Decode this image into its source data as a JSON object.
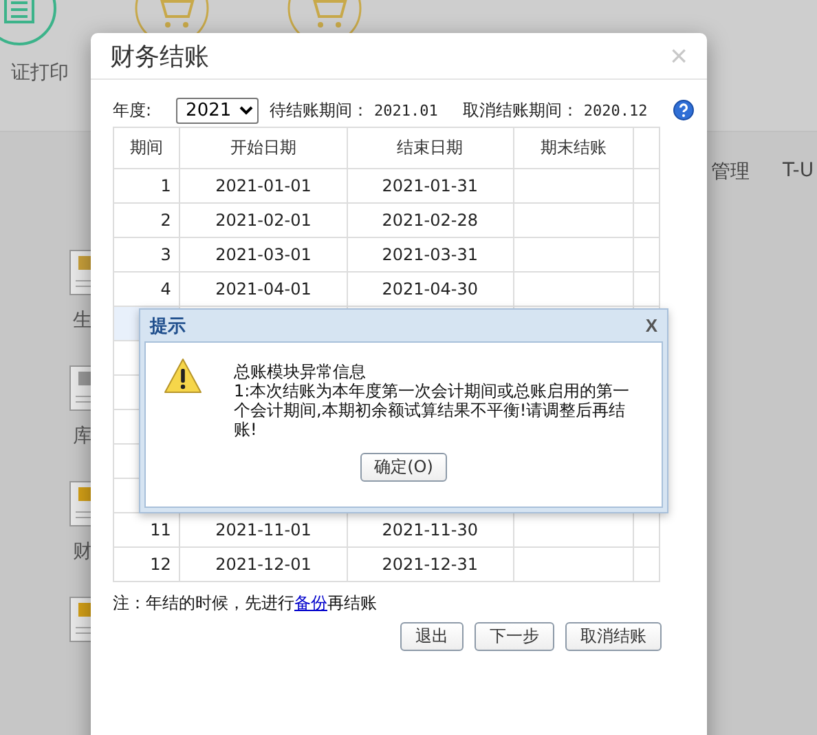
{
  "background": {
    "top_items": [
      {
        "kind": "document",
        "label": "证打印"
      },
      {
        "kind": "cart"
      },
      {
        "kind": "cart"
      }
    ],
    "side_items": [
      {
        "kind": "production",
        "label": "生"
      },
      {
        "kind": "storage",
        "label": "库"
      },
      {
        "kind": "finance",
        "label": "财"
      },
      {
        "kind": "finance"
      }
    ],
    "menu": [
      "管理",
      "T-U"
    ]
  },
  "dialog": {
    "title": "财务结账",
    "close": "×",
    "year_label": "年度:",
    "year": "2021",
    "pending_label": "待结账期间：",
    "pending": "2021.01",
    "cancel_label": "取消结账期间：",
    "cancel": "2020.12",
    "columns": [
      "期间",
      "开始日期",
      "结束日期",
      "期末结账"
    ],
    "rows": [
      [
        "1",
        "2021-01-01",
        "2021-01-31"
      ],
      [
        "2",
        "2021-02-01",
        "2021-02-28"
      ],
      [
        "3",
        "2021-03-01",
        "2021-03-31"
      ],
      [
        "4",
        "2021-04-01",
        "2021-04-30"
      ],
      [
        "11",
        "2021-11-01",
        "2021-11-30"
      ],
      [
        "12",
        "2021-12-01",
        "2021-12-31"
      ]
    ],
    "note": {
      "before": "注：年结的时候，先进行",
      "link": "备份",
      "after": "再结账"
    },
    "buttons": [
      "退出",
      "下一步",
      "取消结账"
    ]
  },
  "alert": {
    "title": "提示",
    "close": "X",
    "heading": "总账模块异常信息",
    "message_lines": [
      "1:本次结账为本年度第一次会计期间或总账启用的第一",
      "个会计期间,本期初余额试算结果不平衡!请调整后再结",
      "账!"
    ],
    "button": "确定(O)"
  }
}
